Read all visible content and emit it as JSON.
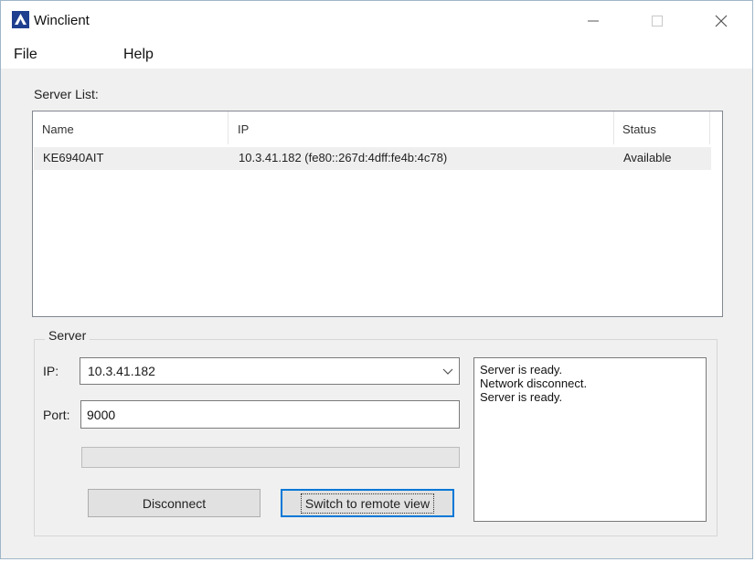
{
  "window": {
    "title": "Winclient",
    "controls": {
      "minimize": "minimize",
      "maximize": "maximize",
      "close": "close"
    }
  },
  "menu": {
    "file": "File",
    "help": "Help"
  },
  "server_list": {
    "label": "Server List:",
    "columns": {
      "name": "Name",
      "ip": "IP",
      "status": "Status"
    },
    "rows": [
      {
        "name": "KE6940AIT",
        "ip": "10.3.41.182 (fe80::267d:4dff:fe4b:4c78)",
        "status": "Available"
      }
    ]
  },
  "server_group": {
    "label": "Server",
    "ip_label": "IP:",
    "ip_value": "10.3.41.182",
    "port_label": "Port:",
    "port_value": "9000",
    "progress_fraction": 0,
    "disconnect_label": "Disconnect",
    "switch_label": "Switch to remote view",
    "log_lines": [
      "Server is ready.",
      "Network disconnect.",
      "Server is ready."
    ]
  },
  "icons": {
    "app": "winclient-app-icon",
    "dropdown": "chevron-down-icon"
  },
  "colors": {
    "accent": "#0078d7",
    "title_bg": "#ffffff",
    "window_bg": "#f0f0f0"
  }
}
